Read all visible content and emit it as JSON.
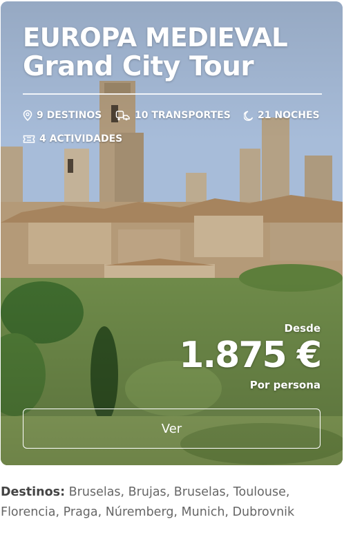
{
  "card": {
    "title_line1": "EUROPA MEDIEVAL",
    "title_line2": "Grand City Tour",
    "features": [
      {
        "icon": "map-pin-icon",
        "label": "9 DESTINOS"
      },
      {
        "icon": "transport-icon",
        "label": "10 TRANSPORTES"
      },
      {
        "icon": "moon-icon",
        "label": "21 NOCHES"
      },
      {
        "icon": "ticket-icon",
        "label": "4 ACTIVIDADES"
      }
    ],
    "price_prefix": "Desde",
    "price": "1.875 €",
    "price_suffix": "Por persona",
    "button_label": "Ver"
  },
  "destinations": {
    "label": "Destinos:",
    "list": "Bruselas, Brujas, Bruselas, Toulouse, Florencia, Praga, Núremberg, Munich, Dubrovnik"
  }
}
